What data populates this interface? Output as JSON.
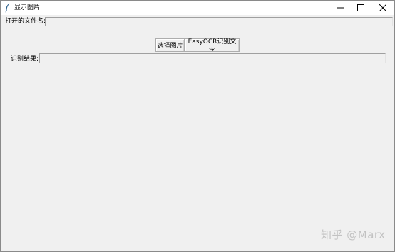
{
  "window": {
    "title": "显示图片",
    "controls": {
      "minimize_icon": "minimize-icon",
      "maximize_icon": "maximize-icon",
      "close_icon": "close-icon"
    }
  },
  "file_row": {
    "label": "打开的文件名:",
    "value": ""
  },
  "buttons": {
    "select_image": "选择图片",
    "easyocr": "EasyOCR识别文字"
  },
  "result_row": {
    "label": "识别结果:",
    "value": ""
  },
  "watermark": "知乎 @Marx"
}
